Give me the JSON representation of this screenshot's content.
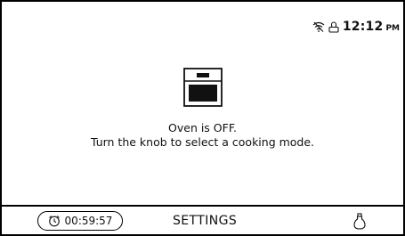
{
  "status": {
    "time": "12:12",
    "ampm": "PM",
    "icons": [
      "wifi-off-icon",
      "remote-control-icon"
    ]
  },
  "main": {
    "icon": "oven-icon",
    "line1": "Oven is OFF.",
    "line2": "Turn the knob to select a cooking mode."
  },
  "bottom": {
    "timer": "00:59:57",
    "timer_icon": "alarm-clock-icon",
    "settings_label": "SETTINGS",
    "light_icon": "oven-light-icon"
  }
}
